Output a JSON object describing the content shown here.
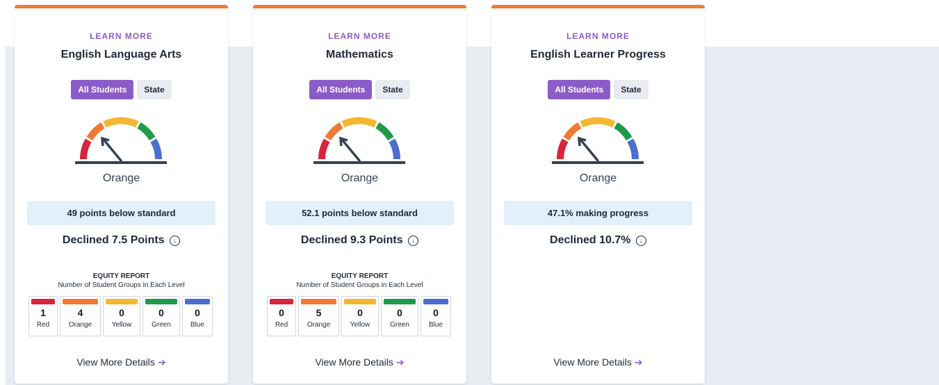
{
  "colors": {
    "accent": "#8b5cc8",
    "card_top": "#f07a35",
    "red": "#d7263d",
    "orange": "#f07a35",
    "yellow": "#f5b731",
    "green": "#1f9a4b",
    "blue": "#4a6fd0"
  },
  "cards": [
    {
      "learn_more": "LEARN MORE",
      "title": "English Language Arts",
      "tab_all": "All Students",
      "tab_state": "State",
      "gauge_level": "Orange",
      "status": "49 points below standard",
      "change": "Declined 7.5 Points",
      "change_icon": "arrow-down-circle-icon",
      "equity": {
        "title": "EQUITY REPORT",
        "subtitle": "Number of Student Groups in Each Level",
        "levels": [
          {
            "label": "Red",
            "count": "1"
          },
          {
            "label": "Orange",
            "count": "4"
          },
          {
            "label": "Yellow",
            "count": "0"
          },
          {
            "label": "Green",
            "count": "0"
          },
          {
            "label": "Blue",
            "count": "0"
          }
        ]
      },
      "view_more": "View More Details"
    },
    {
      "learn_more": "LEARN MORE",
      "title": "Mathematics",
      "tab_all": "All Students",
      "tab_state": "State",
      "gauge_level": "Orange",
      "status": "52.1 points below standard",
      "change": "Declined 9.3 Points",
      "change_icon": "arrow-down-circle-icon",
      "equity": {
        "title": "EQUITY REPORT",
        "subtitle": "Number of Student Groups in Each Level",
        "levels": [
          {
            "label": "Red",
            "count": "0"
          },
          {
            "label": "Orange",
            "count": "5"
          },
          {
            "label": "Yellow",
            "count": "0"
          },
          {
            "label": "Green",
            "count": "0"
          },
          {
            "label": "Blue",
            "count": "0"
          }
        ]
      },
      "view_more": "View More Details"
    },
    {
      "learn_more": "LEARN MORE",
      "title": "English Learner Progress",
      "tab_all": "All Students",
      "tab_state": "State",
      "gauge_level": "Orange",
      "status": "47.1% making progress",
      "change": "Declined 10.7%",
      "change_icon": "arrow-down-circle-icon",
      "view_more": "View More Details"
    }
  ]
}
